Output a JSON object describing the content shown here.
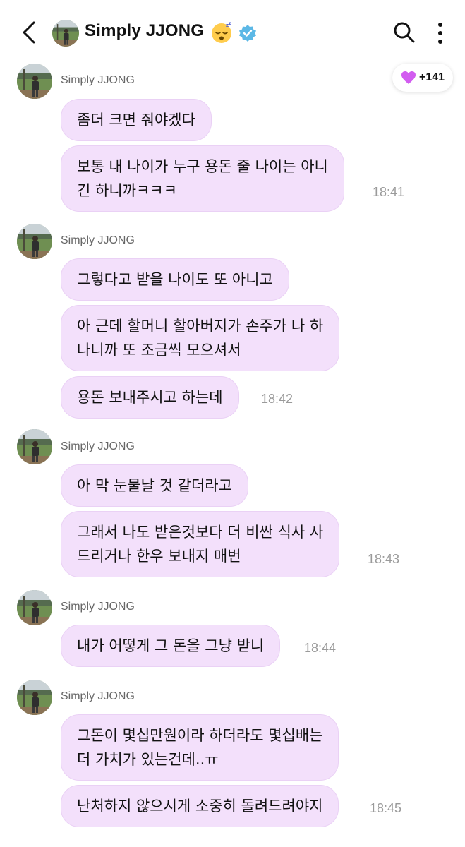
{
  "header": {
    "title": "Simply JJONG",
    "accent_verified": "#5cb8e6"
  },
  "reaction": {
    "count": "+141",
    "icon": "heart-icon",
    "color": "#d25cf0"
  },
  "groups": [
    {
      "sender": "Simply JJONG",
      "messages": [
        "좀더 크면 줘야겠다",
        "보통 내 나이가 누구 용돈 줄 나이는 아니\n긴 하니까ㅋㅋㅋ"
      ],
      "time": "18:41"
    },
    {
      "sender": "Simply JJONG",
      "messages": [
        "그렇다고 받을 나이도 또 아니고",
        "아 근데 할머니 할아버지가 손주가 나 하\n나니까 또 조금씩 모으셔서",
        "용돈 보내주시고 하는데"
      ],
      "time": "18:42"
    },
    {
      "sender": "Simply JJONG",
      "messages": [
        "아 막 눈물날 것 같더라고",
        "그래서 나도 받은것보다 더 비싼 식사 사\n드리거나 한우 보내지 매번"
      ],
      "time": "18:43"
    },
    {
      "sender": "Simply JJONG",
      "messages": [
        "내가 어떻게 그 돈을 그냥 받니"
      ],
      "time": "18:44"
    },
    {
      "sender": "Simply JJONG",
      "messages": [
        "그돈이 몇십만원이라 하더라도 몇십배는\n더 가치가 있는건데..ㅠ",
        "난처하지 않으시게 소중히 돌려드려야지"
      ],
      "time": "18:45"
    }
  ]
}
